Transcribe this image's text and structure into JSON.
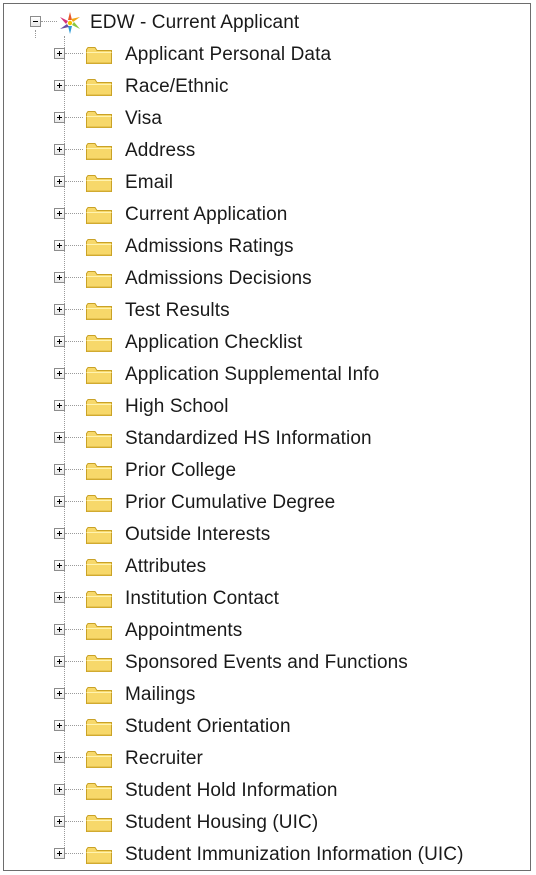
{
  "tree": {
    "root": {
      "label": "EDW - Current Applicant",
      "icon": "universe-star-icon",
      "expanded": true
    },
    "items": [
      {
        "label": "Applicant Personal Data"
      },
      {
        "label": "Race/Ethnic"
      },
      {
        "label": "Visa"
      },
      {
        "label": "Address"
      },
      {
        "label": "Email"
      },
      {
        "label": "Current Application"
      },
      {
        "label": "Admissions Ratings"
      },
      {
        "label": "Admissions Decisions"
      },
      {
        "label": "Test Results"
      },
      {
        "label": "Application Checklist"
      },
      {
        "label": "Application Supplemental Info"
      },
      {
        "label": "High School"
      },
      {
        "label": "Standardized HS Information"
      },
      {
        "label": "Prior College"
      },
      {
        "label": "Prior Cumulative Degree"
      },
      {
        "label": "Outside Interests"
      },
      {
        "label": "Attributes"
      },
      {
        "label": "Institution Contact"
      },
      {
        "label": "Appointments"
      },
      {
        "label": "Sponsored Events and Functions"
      },
      {
        "label": "Mailings"
      },
      {
        "label": "Student Orientation"
      },
      {
        "label": "Recruiter"
      },
      {
        "label": "Student Hold Information"
      },
      {
        "label": "Student Housing (UIC)"
      },
      {
        "label": "Student Immunization Information (UIC)"
      }
    ]
  },
  "colors": {
    "folder_fill": "#f7d86a",
    "folder_edge": "#c9a227",
    "connector": "#9a9a9a"
  }
}
